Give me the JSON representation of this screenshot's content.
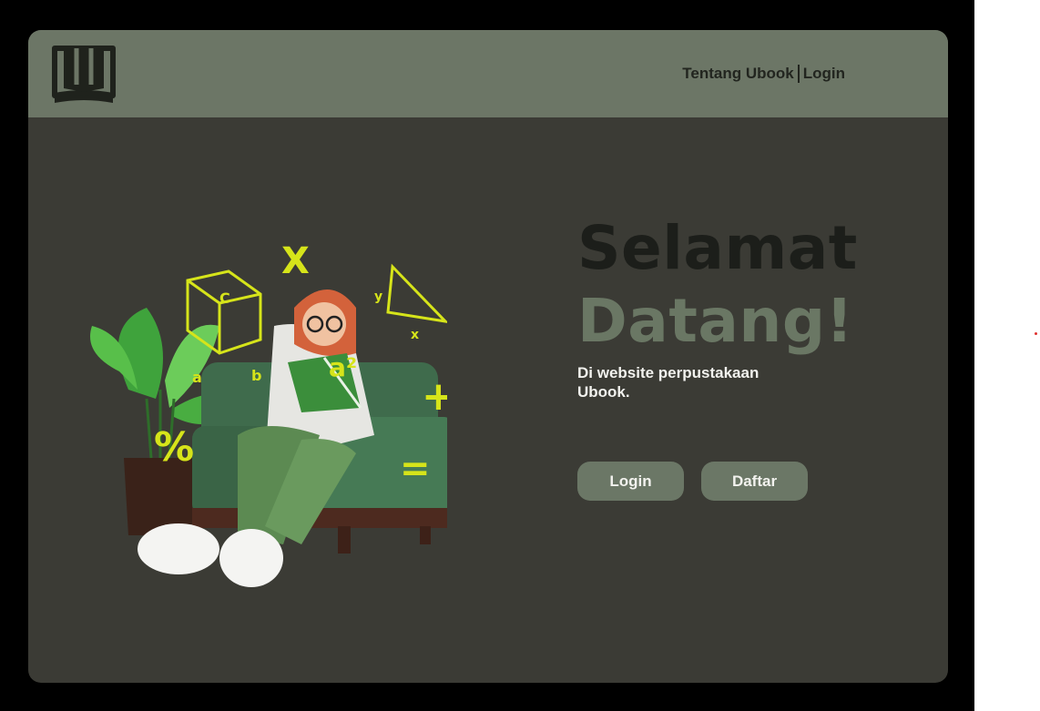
{
  "nav": {
    "about_label": "Tentang Ubook",
    "login_label": "Login"
  },
  "hero": {
    "title_line1": "Selamat",
    "title_line2": "Datang!",
    "subtitle": "Di website perpustakaan Ubook."
  },
  "buttons": {
    "login_label": "Login",
    "register_label": "Daftar"
  },
  "illustration": {
    "math_symbols": [
      "X",
      "C",
      "a",
      "b",
      "y",
      "x",
      "a²",
      "%",
      "+",
      "="
    ]
  },
  "icons": {
    "logo": "book-icon"
  },
  "colors": {
    "header_bg": "#6c7666",
    "page_bg": "#3b3b35",
    "accent_green": "#6a7764",
    "math_yellow": "#d6e41a"
  }
}
